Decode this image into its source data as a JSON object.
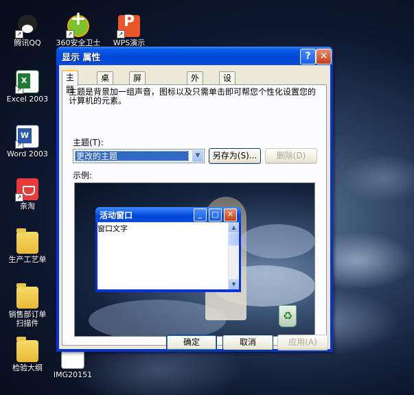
{
  "desktop": {
    "icons": [
      {
        "label": "腾讯QQ",
        "icon": "qq-icon"
      },
      {
        "label": "360安全卫士",
        "icon": "360-security-icon"
      },
      {
        "label": "WPS演示",
        "icon": "wps-presentation-icon"
      },
      {
        "label": "Excel 2003",
        "icon": "excel-icon"
      },
      {
        "label": "Word 2003",
        "icon": "word-icon"
      },
      {
        "label": "亲淘",
        "icon": "qintao-icon"
      },
      {
        "label": "生产工艺单",
        "icon": "folder-icon"
      },
      {
        "label": "销售部订单扫描件",
        "icon": "folder-icon"
      },
      {
        "label": "检验大纲",
        "icon": "folder-icon"
      },
      {
        "label": "IMG20151",
        "icon": "image-file-icon"
      }
    ]
  },
  "dialog": {
    "title": "显示 属性",
    "help_glyph": "?",
    "close_glyph": "✕",
    "tabs": [
      {
        "label": "主题",
        "active": true
      },
      {
        "label": "桌面",
        "active": false
      },
      {
        "label": "屏幕保护程序",
        "active": false
      },
      {
        "label": "外观",
        "active": false
      },
      {
        "label": "设置",
        "active": false
      }
    ],
    "description": "主题是背景加一组声音，图标以及只需单击即可帮您个性化设置您的计算机的元素。",
    "theme_label": "主题(T):",
    "theme_value": "更改的主题",
    "save_as_label": "另存为(S)...",
    "delete_label": "删除(D)",
    "sample_label": "示例:",
    "ok_label": "确定",
    "cancel_label": "取消",
    "apply_label": "应用(A)"
  },
  "preview": {
    "window_title": "活动窗口",
    "window_text": "窗口文字"
  },
  "colors": {
    "titlebar": "#0046d8",
    "dialog_face": "#ece9d8",
    "selection": "#316ac5",
    "tab_highlight": "#ffc83c"
  }
}
